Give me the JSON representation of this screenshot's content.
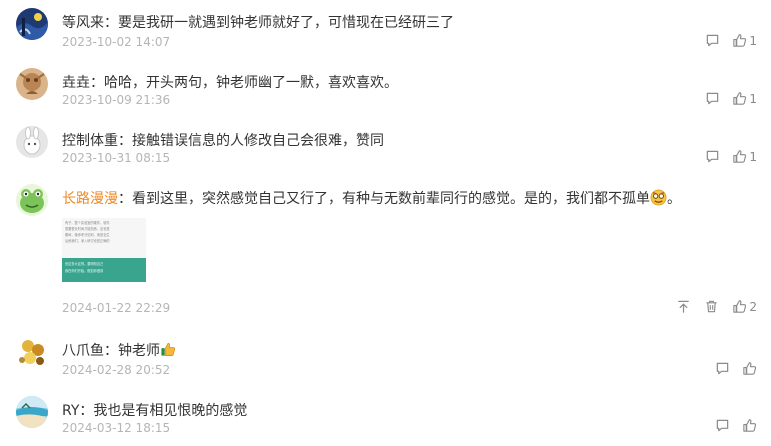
{
  "colors": {
    "username_highlight": "#f08a24",
    "meta": "#b5b5b5",
    "icon": "#8a8a8a",
    "image_band": "#3aa58f"
  },
  "icons": {
    "comment": "speech-bubble",
    "like": "thumbs-up",
    "pin": "pin-to-top",
    "delete": "trash-can"
  },
  "comments": [
    {
      "user": "等风来",
      "separator": "：",
      "text": "要是我研一就遇到钟老师就好了，可惜现在已经研三了",
      "date": "2023-10-02 14:07",
      "likes": "1"
    },
    {
      "user": "垚垚",
      "separator": "：",
      "text": "哈哈，开头两句，钟老师幽了一默，喜欢喜欢。",
      "date": "2023-10-09 21:36",
      "likes": "1"
    },
    {
      "user": "控制体重",
      "separator": "：",
      "text": "接触错误信息的人修改自己会很难，赞同",
      "date": "2023-10-31 08:15",
      "likes": "1"
    },
    {
      "user": "长路漫漫",
      "separator": "：",
      "text": "看到这里，突然感觉自己又行了，有种与无数前辈同行的感觉。是的，我们都不孤单",
      "text_after_emoji": "。",
      "emoji": "nerd-face-emoji",
      "date": "2024-01-22 22:29",
      "likes": "2",
      "image_lines": [
        "有子。整个实验室的硬件、软件",
        "需要很长时间才能熟悉，这也是",
        "期间，像你考分如何，而是全生",
        "后他我们，深入研讨也是正确的",
        "但这多大区别。要明知自己",
        "我在你们开始。假如你做到"
      ]
    },
    {
      "user": "八爪鱼",
      "separator": "：",
      "text": "钟老师",
      "emoji": "thumbs-up-emoji",
      "date": "2024-02-28 20:52"
    },
    {
      "user": "RY",
      "separator": "：",
      "text": "我也是有相见恨晚的感觉",
      "date": "2024-03-12 18:15"
    }
  ]
}
